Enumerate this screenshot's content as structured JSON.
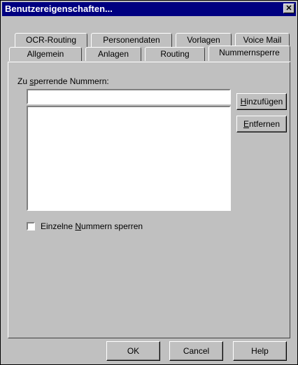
{
  "window": {
    "title": "Benutzereigenschaften...",
    "close_glyph": "✕"
  },
  "tabs": {
    "row_back": [
      {
        "label": "OCR-Routing"
      },
      {
        "label": "Personendaten"
      },
      {
        "label": "Vorlagen"
      },
      {
        "label": "Voice Mail"
      }
    ],
    "row_front": [
      {
        "label": "Allgemein"
      },
      {
        "label": "Anlagen"
      },
      {
        "label": "Routing"
      },
      {
        "label": "Nummernsperre",
        "active": true
      }
    ]
  },
  "panel": {
    "numbers_label_pre": "Zu ",
    "numbers_label_accel": "s",
    "numbers_label_post": "perrende Nummern:",
    "number_input_value": "",
    "numbers_list": [],
    "add_button_accel": "H",
    "add_button_rest": "inzufügen",
    "remove_button_accel": "E",
    "remove_button_rest": "ntfernen",
    "single_block_pre": "Einzelne ",
    "single_block_accel": "N",
    "single_block_post": "ummern sperren",
    "single_block_checked": false
  },
  "footer": {
    "ok_label": "OK",
    "cancel_label": "Cancel",
    "help_label": "Help"
  }
}
